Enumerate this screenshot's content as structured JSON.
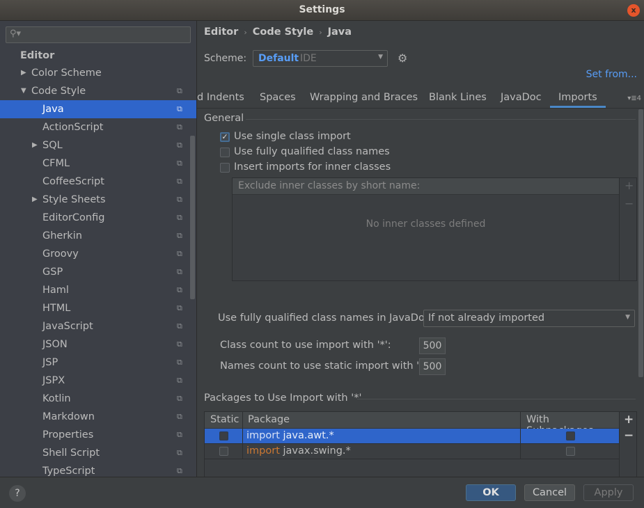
{
  "window": {
    "title": "Settings",
    "close_glyph": "x"
  },
  "sidebar": {
    "search": {
      "value": "",
      "placeholder": ""
    },
    "section_header": "Editor",
    "items": [
      {
        "label": "Color Scheme",
        "level": 1,
        "arrow": "▶",
        "copy": false,
        "selected": false
      },
      {
        "label": "Code Style",
        "level": 1,
        "arrow": "▼",
        "copy": true,
        "selected": false
      },
      {
        "label": "Java",
        "level": 2,
        "arrow": "",
        "copy": true,
        "selected": true
      },
      {
        "label": "ActionScript",
        "level": 2,
        "arrow": "",
        "copy": true,
        "selected": false
      },
      {
        "label": "SQL",
        "level": 2,
        "arrow": "▶",
        "copy": true,
        "selected": false
      },
      {
        "label": "CFML",
        "level": 2,
        "arrow": "",
        "copy": true,
        "selected": false
      },
      {
        "label": "CoffeeScript",
        "level": 2,
        "arrow": "",
        "copy": true,
        "selected": false
      },
      {
        "label": "Style Sheets",
        "level": 2,
        "arrow": "▶",
        "copy": true,
        "selected": false
      },
      {
        "label": "EditorConfig",
        "level": 2,
        "arrow": "",
        "copy": true,
        "selected": false
      },
      {
        "label": "Gherkin",
        "level": 2,
        "arrow": "",
        "copy": true,
        "selected": false
      },
      {
        "label": "Groovy",
        "level": 2,
        "arrow": "",
        "copy": true,
        "selected": false
      },
      {
        "label": "GSP",
        "level": 2,
        "arrow": "",
        "copy": true,
        "selected": false
      },
      {
        "label": "Haml",
        "level": 2,
        "arrow": "",
        "copy": true,
        "selected": false
      },
      {
        "label": "HTML",
        "level": 2,
        "arrow": "",
        "copy": true,
        "selected": false
      },
      {
        "label": "JavaScript",
        "level": 2,
        "arrow": "",
        "copy": true,
        "selected": false
      },
      {
        "label": "JSON",
        "level": 2,
        "arrow": "",
        "copy": true,
        "selected": false
      },
      {
        "label": "JSP",
        "level": 2,
        "arrow": "",
        "copy": true,
        "selected": false
      },
      {
        "label": "JSPX",
        "level": 2,
        "arrow": "",
        "copy": true,
        "selected": false
      },
      {
        "label": "Kotlin",
        "level": 2,
        "arrow": "",
        "copy": true,
        "selected": false
      },
      {
        "label": "Markdown",
        "level": 2,
        "arrow": "",
        "copy": true,
        "selected": false
      },
      {
        "label": "Properties",
        "level": 2,
        "arrow": "",
        "copy": true,
        "selected": false
      },
      {
        "label": "Shell Script",
        "level": 2,
        "arrow": "",
        "copy": true,
        "selected": false
      },
      {
        "label": "TypeScript",
        "level": 2,
        "arrow": "",
        "copy": true,
        "selected": false
      }
    ]
  },
  "breadcrumb": [
    "Editor",
    "Code Style",
    "Java"
  ],
  "breadcrumb_sep": "›",
  "scheme": {
    "label": "Scheme:",
    "name": "Default",
    "kind": "IDE"
  },
  "set_from": "Set from...",
  "tabs": {
    "items": [
      "d Indents",
      "Spaces",
      "Wrapping and Braces",
      "Blank Lines",
      "JavaDoc",
      "Imports"
    ],
    "active": "Imports",
    "more_count": "4"
  },
  "general": {
    "title": "General",
    "checkboxes": [
      {
        "label": "Use single class import",
        "checked": true
      },
      {
        "label": "Use fully qualified class names",
        "checked": false
      },
      {
        "label": "Insert imports for inner classes",
        "checked": false
      }
    ],
    "exclude_header": "Exclude inner classes by short name:",
    "exclude_empty": "No inner classes defined",
    "javadoc_label": "Use fully qualified class names in JavaDoc:",
    "javadoc_value": "If not already imported",
    "class_count_label": "Class count to use import with '*':",
    "class_count_value": "500",
    "names_count_label": "Names count to use static import with '*':",
    "names_count_value": "500"
  },
  "packages": {
    "title": "Packages to Use Import with '*'",
    "columns": [
      "Static",
      "Package",
      "With Subpackages"
    ],
    "rows": [
      {
        "static": false,
        "keyword": "import",
        "package": "java.awt.*",
        "with_subpackages": false,
        "selected": true
      },
      {
        "static": false,
        "keyword": "import",
        "package": "javax.swing.*",
        "with_subpackages": false,
        "selected": false
      }
    ]
  },
  "footer": {
    "help": "?",
    "ok": "OK",
    "cancel": "Cancel",
    "apply": "Apply"
  },
  "colors": {
    "accent": "#2f65ca",
    "link": "#589df6",
    "keyword": "#cc7832",
    "tab_underline": "#4a88c7"
  }
}
